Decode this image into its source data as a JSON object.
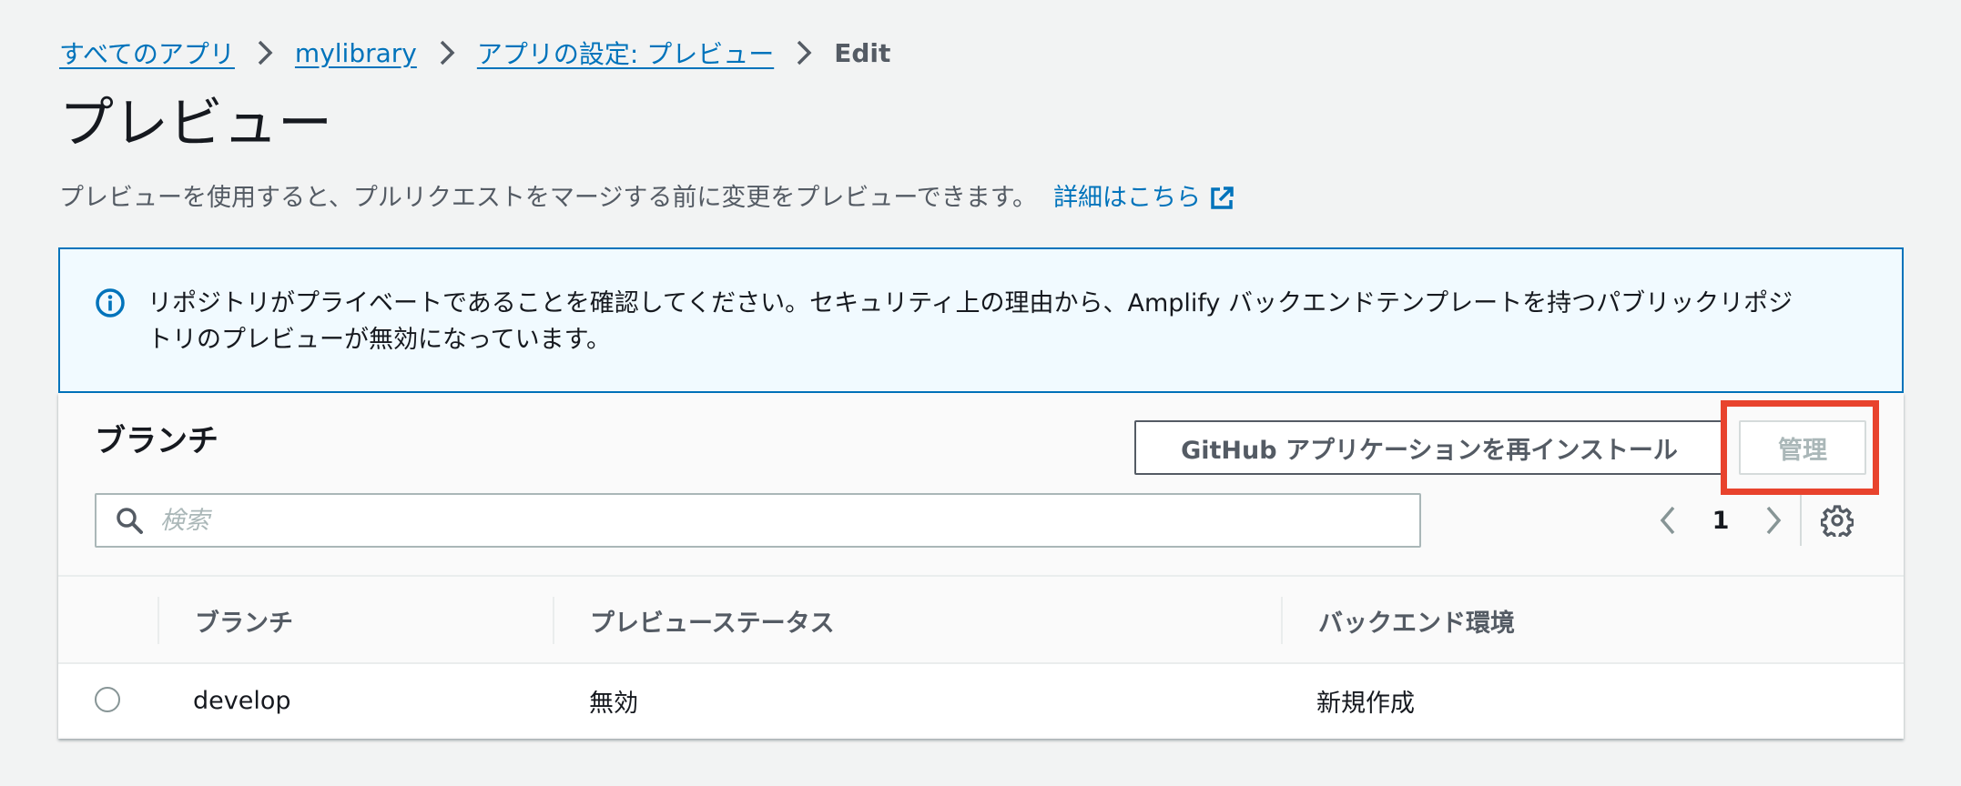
{
  "breadcrumb": {
    "items": [
      {
        "label": "すべてのアプリ"
      },
      {
        "label": "mylibrary"
      },
      {
        "label": "アプリの設定: プレビュー"
      }
    ],
    "current": "Edit"
  },
  "page": {
    "title": "プレビュー",
    "description": "プレビューを使用すると、プルリクエストをマージする前に変更をプレビューできます。",
    "info_link": "詳細はこちら"
  },
  "alert": {
    "line1": "リポジトリがプライベートであることを確認してください。セキュリティ上の理由から、Amplify バックエンドテンプレートを持つパブリックリポジ",
    "line2": "トリのプレビューが無効になっています。"
  },
  "panel": {
    "title": "ブランチ",
    "reinstall_button": "GitHub アプリケーションを再インストール",
    "manage_button": "管理"
  },
  "search": {
    "placeholder": "検索",
    "value": ""
  },
  "pagination": {
    "current_page": "1"
  },
  "table": {
    "headers": [
      "ブランチ",
      "プレビューステータス",
      "バックエンド環境"
    ],
    "rows": [
      {
        "branch": "develop",
        "status": "無効",
        "backend": "新規作成"
      }
    ]
  },
  "colors": {
    "link": "#0073bb",
    "highlight": "#e8432d",
    "alert_border": "#0073bb",
    "alert_bg": "#f1faff"
  }
}
